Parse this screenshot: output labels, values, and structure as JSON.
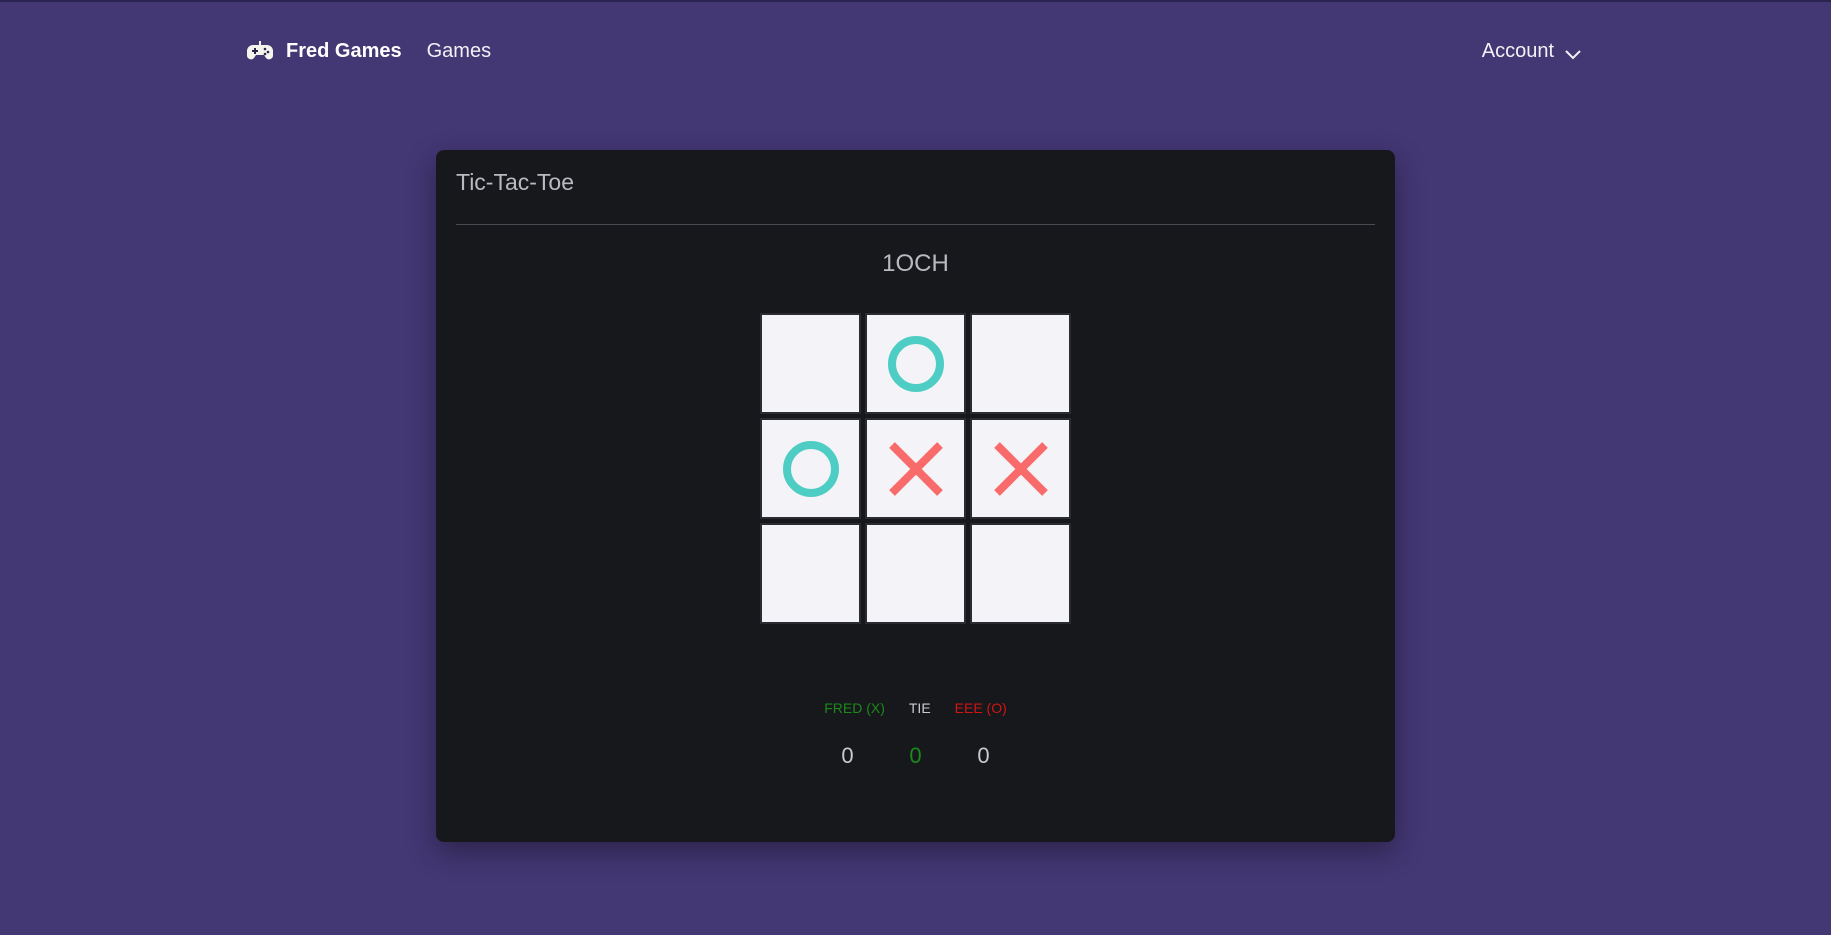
{
  "nav": {
    "brand": "Fred Games",
    "games_link": "Games",
    "account_label": "Account"
  },
  "card": {
    "title": "Tic-Tac-Toe",
    "room_code": "1OCH"
  },
  "board": {
    "cells": [
      "",
      "O",
      "",
      "O",
      "X",
      "X",
      "",
      "",
      ""
    ]
  },
  "scoreboard": {
    "labels": {
      "player_x": "FRED (X)",
      "tie": "TIE",
      "player_o": "EEE (O)"
    },
    "values": {
      "player_x": "0",
      "tie": "0",
      "player_o": "0"
    }
  },
  "colors": {
    "background": "#433774",
    "card": "#17181c",
    "x_mark": "#f96b6b",
    "o_mark": "#4ecdc4",
    "player_x_label": "#1a8a1a",
    "tie_label": "#c9c9cf",
    "player_o_label": "#d11414",
    "tie_value": "#1a8a1a",
    "score_value": "#c9c9cf"
  },
  "icons": {
    "brand": "gamepad-icon",
    "account": "chevron-down-icon",
    "x_mark": "x-mark-icon",
    "o_mark": "o-mark-icon"
  }
}
